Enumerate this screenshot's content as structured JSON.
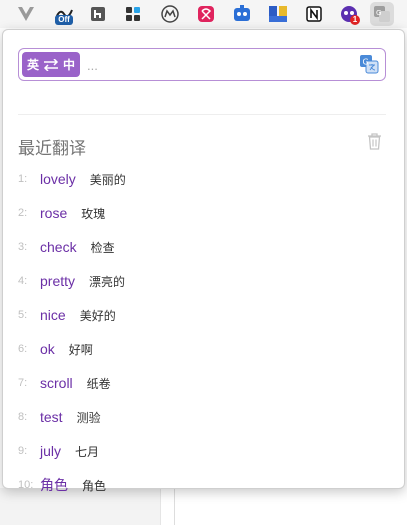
{
  "toolbar": {
    "badges": {
      "off": "Off",
      "count": "1"
    },
    "extensions": [
      "vue-devtools-icon",
      "tampermonkey-icon",
      "hypothesis-icon",
      "app-grid-icon",
      "momentum-icon",
      "pocket-icon",
      "robot-icon",
      "translate-flags-icon",
      "notion-icon",
      "chat-bot-icon",
      "translator-extension-icon"
    ]
  },
  "popup": {
    "lang_from": "英",
    "lang_to": "中",
    "search_placeholder": "...",
    "recent_title": "最近翻译",
    "history": [
      {
        "index": "1:",
        "word": "lovely",
        "meaning": "美丽的"
      },
      {
        "index": "2:",
        "word": "rose",
        "meaning": "玫瑰"
      },
      {
        "index": "3:",
        "word": "check",
        "meaning": "检查"
      },
      {
        "index": "4:",
        "word": "pretty",
        "meaning": "漂亮的"
      },
      {
        "index": "5:",
        "word": "nice",
        "meaning": "美好的"
      },
      {
        "index": "6:",
        "word": "ok",
        "meaning": "好啊"
      },
      {
        "index": "7:",
        "word": "scroll",
        "meaning": "纸卷"
      },
      {
        "index": "8:",
        "word": "test",
        "meaning": "测验"
      },
      {
        "index": "9:",
        "word": "july",
        "meaning": "七月"
      },
      {
        "index": "10:",
        "word": "角色",
        "meaning": "角色"
      }
    ]
  },
  "colors": {
    "accent": "#9a63c9",
    "word": "#6b2fa6",
    "border": "#b78fd6"
  }
}
